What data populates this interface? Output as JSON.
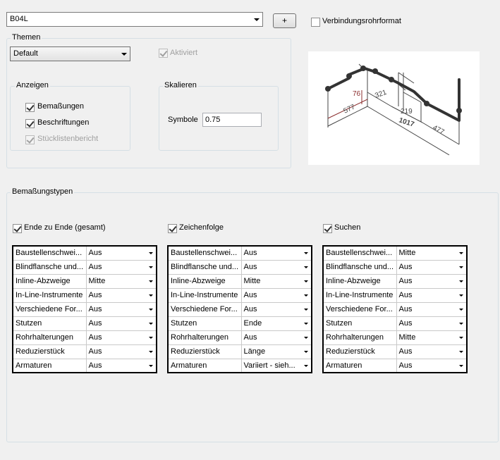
{
  "top": {
    "profile_value": "B04L",
    "add_button": "+",
    "connector_format_label": "Verbindungsrohrformat"
  },
  "themes": {
    "title": "Themen",
    "theme_value": "Default",
    "active_label": "Aktiviert",
    "display": {
      "title": "Anzeigen",
      "dimensions_label": "Bemaßungen",
      "labels_label": "Beschriftungen",
      "bom_label": "Stücklistenbericht"
    },
    "scale": {
      "title": "Skalieren",
      "symbols_label": "Symbole",
      "symbols_value": "0.75"
    }
  },
  "preview": {
    "dims": [
      "577",
      "76",
      "321",
      "219",
      "1017",
      "477"
    ]
  },
  "dimension_types": {
    "title": "Bemaßungstypen",
    "tables": [
      {
        "header": "Ende zu Ende (gesamt)",
        "rows": [
          {
            "name": "Baustellenschwei...",
            "value": "Aus"
          },
          {
            "name": "Blindflansche und...",
            "value": "Aus"
          },
          {
            "name": "Inline-Abzweige",
            "value": "Mitte"
          },
          {
            "name": "In-Line-Instrumente",
            "value": "Aus"
          },
          {
            "name": "Verschiedene For...",
            "value": "Aus"
          },
          {
            "name": "Stutzen",
            "value": "Aus"
          },
          {
            "name": "Rohrhalterungen",
            "value": "Aus"
          },
          {
            "name": "Reduzierstück",
            "value": "Aus"
          },
          {
            "name": "Armaturen",
            "value": "Aus"
          }
        ]
      },
      {
        "header": "Zeichenfolge",
        "rows": [
          {
            "name": "Baustellenschwei...",
            "value": "Aus"
          },
          {
            "name": "Blindflansche und...",
            "value": "Aus"
          },
          {
            "name": "Inline-Abzweige",
            "value": "Mitte"
          },
          {
            "name": "In-Line-Instrumente",
            "value": "Aus"
          },
          {
            "name": "Verschiedene For...",
            "value": "Aus"
          },
          {
            "name": "Stutzen",
            "value": "Ende"
          },
          {
            "name": "Rohrhalterungen",
            "value": "Aus"
          },
          {
            "name": "Reduzierstück",
            "value": "Länge"
          },
          {
            "name": "Armaturen",
            "value": "Variiert - sieh..."
          }
        ]
      },
      {
        "header": "Suchen",
        "rows": [
          {
            "name": "Baustellenschwei...",
            "value": "Mitte"
          },
          {
            "name": "Blindflansche und...",
            "value": "Aus"
          },
          {
            "name": "Inline-Abzweige",
            "value": "Aus"
          },
          {
            "name": "In-Line-Instrumente",
            "value": "Aus"
          },
          {
            "name": "Verschiedene For...",
            "value": "Aus"
          },
          {
            "name": "Stutzen",
            "value": "Aus"
          },
          {
            "name": "Rohrhalterungen",
            "value": "Mitte"
          },
          {
            "name": "Reduzierstück",
            "value": "Aus"
          },
          {
            "name": "Armaturen",
            "value": "Aus"
          }
        ]
      }
    ]
  }
}
